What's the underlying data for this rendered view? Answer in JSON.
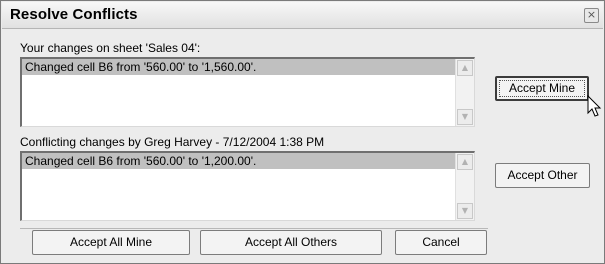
{
  "dialog": {
    "title": "Resolve Conflicts",
    "close_glyph": "×"
  },
  "your_changes": {
    "label": "Your changes on sheet 'Sales 04':",
    "items": [
      "Changed cell B6 from '560.00' to '1,560.00'."
    ]
  },
  "conflicting_changes": {
    "label": "Conflicting changes by Greg Harvey - 7/12/2004 1:38 PM",
    "items": [
      "Changed cell B6 from '560.00' to '1,200.00'."
    ]
  },
  "buttons": {
    "accept_mine": "Accept Mine",
    "accept_other": "Accept Other",
    "accept_all_mine": "Accept All Mine",
    "accept_all_others": "Accept All Others",
    "cancel": "Cancel"
  },
  "icons": {
    "scroll_up": "▲",
    "scroll_down": "▼"
  }
}
